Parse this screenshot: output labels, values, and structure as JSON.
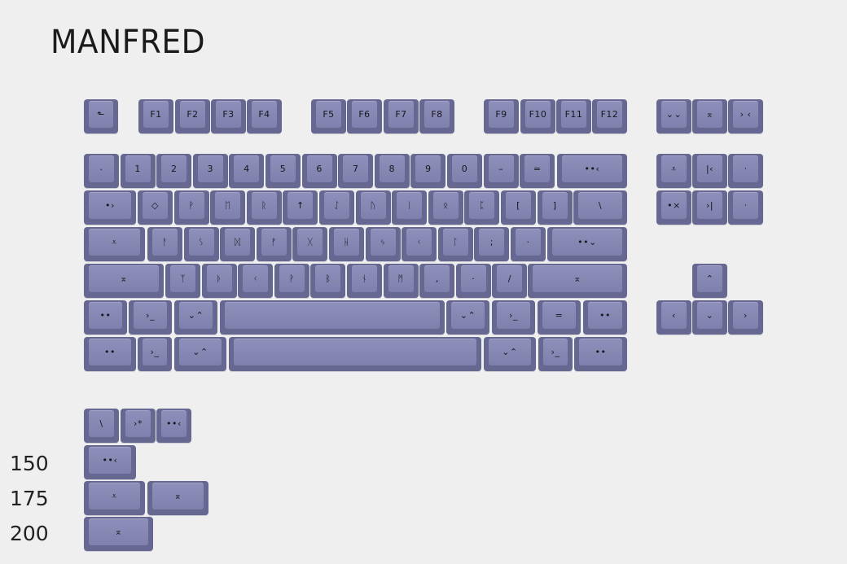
{
  "title": "MANFRED",
  "size_labels": [
    "150",
    "175",
    "200"
  ],
  "function_row": {
    "esc": "⬑",
    "f_keys": [
      "F1",
      "F2",
      "F3",
      "F4",
      "F5",
      "F6",
      "F7",
      "F8",
      "F9",
      "F10",
      "F11",
      "F12"
    ],
    "extra": [
      "⌄⌄",
      "⌅",
      "› ‹"
    ]
  },
  "number_row": [
    "˴",
    "1",
    "2",
    "3",
    "4",
    "5",
    "6",
    "7",
    "8",
    "9",
    "0",
    "–",
    "=",
    "••‹"
  ],
  "tab_row": [
    "•›",
    "◇",
    "ᚹ",
    "ᛖ",
    "ᚱ",
    "↑",
    "ᛇ",
    "ᚢ",
    "ᛁ",
    "ᛟ",
    "ᛈ",
    "[",
    "]",
    "\\"
  ],
  "caps_row": [
    "⩡",
    "ᚨ",
    "ᛊ",
    "ᛞ",
    "ᚠ",
    "ᚷ",
    "ᚺ",
    "ᛃ",
    "ᚲ",
    "ᛚ",
    ";",
    "·",
    "••⌄"
  ],
  "shift_row": [
    "⌅",
    "ᛉ",
    "ᚦ",
    "ᚲ",
    "ᚹ",
    "ᛒ",
    "ᚾ",
    "ᛗ",
    "‚",
    "·",
    "/",
    "⌅"
  ],
  "bottom_row_a": [
    "••",
    "›_",
    "⌄⌃",
    "",
    "⌄⌃",
    "›_",
    "=",
    "••"
  ],
  "bottom_row_b": [
    "••",
    "›_",
    "⌄⌃",
    "",
    "⌄⌃",
    "›_",
    "••"
  ],
  "nav_cluster": [
    "⩡",
    "|‹",
    "ᐧ",
    "•×",
    "›|",
    "ᐧ"
  ],
  "arrow_keys": [
    "⌃",
    "‹",
    "⌄",
    "›"
  ],
  "extras_row": [
    "\\",
    "›*",
    "••‹"
  ],
  "extras_150": "••‹",
  "extras_175": [
    "⩡",
    "⌅"
  ],
  "extras_200": "⌅"
}
